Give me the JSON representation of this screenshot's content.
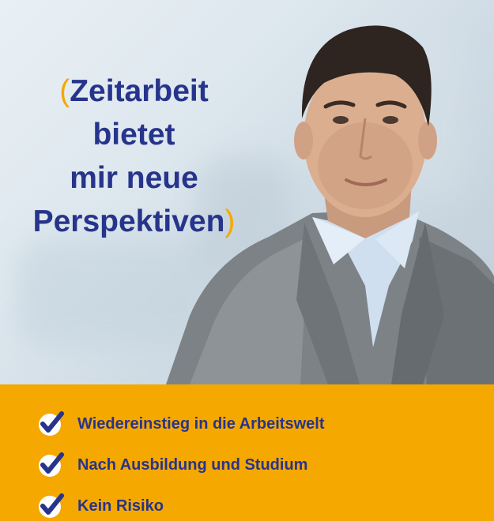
{
  "headline": {
    "open_paren": "(",
    "lines": [
      "Zeitarbeit",
      "bietet",
      "mir neue",
      "Perspektiven"
    ],
    "close_paren": ")"
  },
  "benefits": [
    {
      "label": "Wiedereinstieg in die Arbeitswelt",
      "icon": "checkmark-icon"
    },
    {
      "label": "Nach Ausbildung und Studium",
      "icon": "checkmark-icon"
    },
    {
      "label": "Kein Risiko",
      "icon": "checkmark-icon"
    }
  ],
  "colors": {
    "brand_blue": "#27348b",
    "accent_orange": "#f5a800",
    "background": "#dde7ee"
  }
}
